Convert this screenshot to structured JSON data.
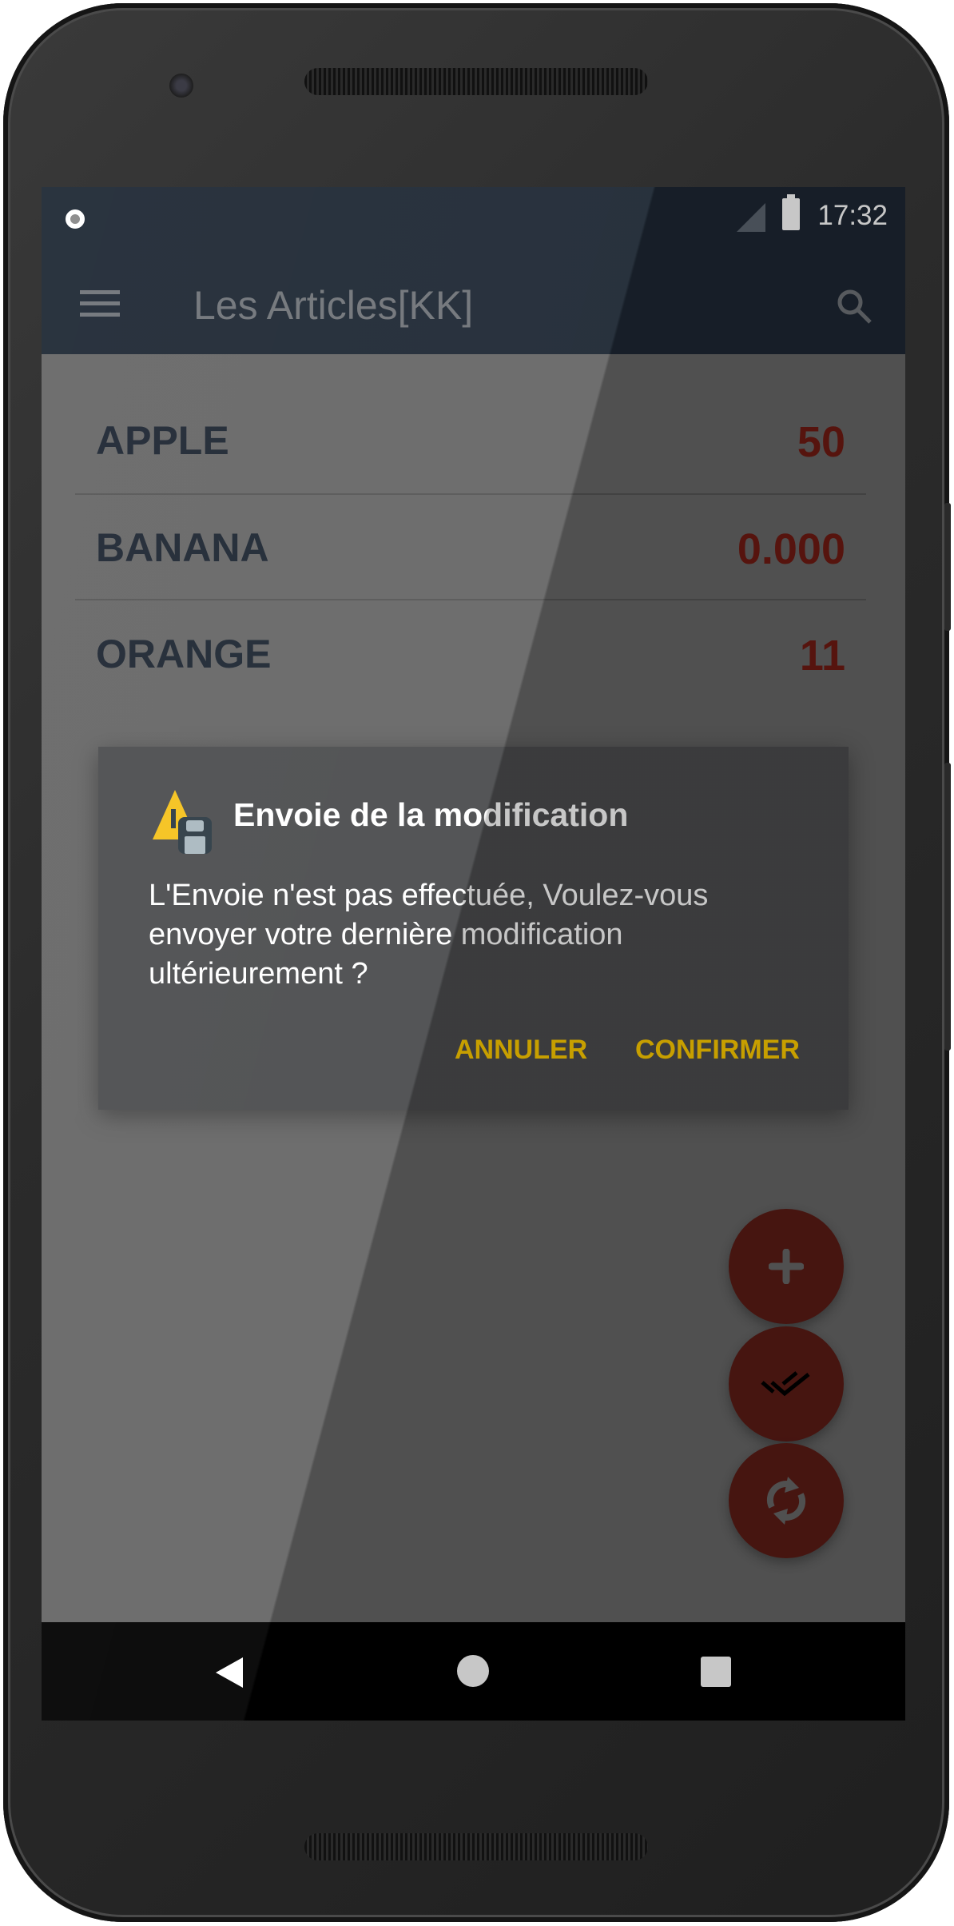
{
  "status_bar": {
    "time": "17:32"
  },
  "app_bar": {
    "title": "Les Articles[KK]"
  },
  "articles": [
    {
      "name": "APPLE",
      "value": "50"
    },
    {
      "name": "BANANA",
      "value": "0.000"
    },
    {
      "name": "ORANGE",
      "value": "11"
    }
  ],
  "dialog": {
    "title": "Envoie de la modification",
    "message": "L'Envoie n'est pas effectuée, Voulez-vous envoyer votre dernière modification ultérieurement ?",
    "cancel_label": "ANNULER",
    "confirm_label": "CONFIRMER"
  },
  "colors": {
    "app_bar": "#1d2733",
    "value_text": "#6e1a12",
    "dialog_button": "#ffcc00",
    "fab": "#5a1b15",
    "dialog_bg": "#4b4c4e"
  },
  "fabs": [
    {
      "icon": "plus-icon"
    },
    {
      "icon": "double-check-icon"
    },
    {
      "icon": "sync-icon"
    }
  ]
}
